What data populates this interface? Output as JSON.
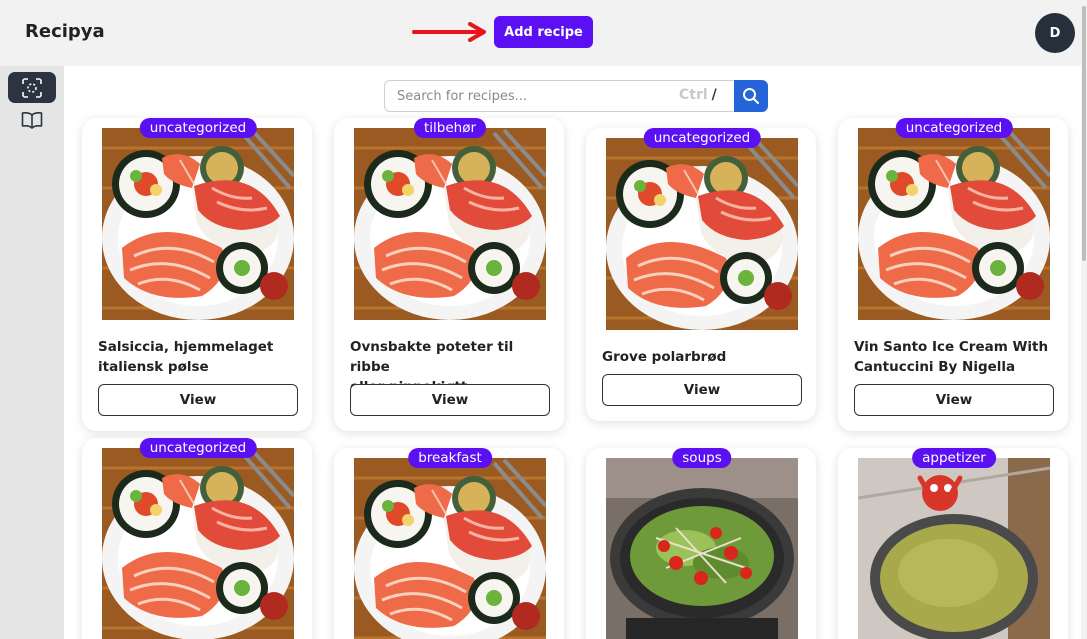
{
  "app": {
    "brand": "Recipya"
  },
  "header": {
    "add_recipe_label": "Add recipe",
    "avatar_initial": "D"
  },
  "search": {
    "placeholder": "Search for recipes...",
    "shortcut_key": "Ctrl",
    "shortcut_slash": "/"
  },
  "colors": {
    "accent": "#5a10f2",
    "search_button": "#2563d9",
    "arrow": "#e8141c",
    "avatar": "#26303d"
  },
  "sidebar": {
    "items": [
      {
        "icon": "scan-icon"
      },
      {
        "icon": "book-open-icon"
      }
    ]
  },
  "recipes": [
    {
      "category": "uncategorized",
      "title_line1": "Salsiccia, hjemmelaget",
      "title_line2": "italiensk pølse",
      "view_label": "View",
      "image": "sushi"
    },
    {
      "category": "tilbehør",
      "title_line1": "Ovnsbakte poteter til ribbe",
      "title_line2": "eller pinnekjøtt",
      "view_label": "View",
      "image": "sushi"
    },
    {
      "category": "uncategorized",
      "title_line1": "Grove polarbrød",
      "title_line2": "",
      "view_label": "View",
      "image": "sushi"
    },
    {
      "category": "uncategorized",
      "title_line1": "Vin Santo Ice Cream With",
      "title_line2": "Cantuccini By Nigella",
      "view_label": "View",
      "image": "sushi"
    },
    {
      "category": "uncategorized",
      "image": "sushi"
    },
    {
      "category": "breakfast",
      "image": "sushi"
    },
    {
      "category": "soups",
      "image": "salad-pot"
    },
    {
      "category": "appetizer",
      "image": "soup-bowl"
    }
  ]
}
